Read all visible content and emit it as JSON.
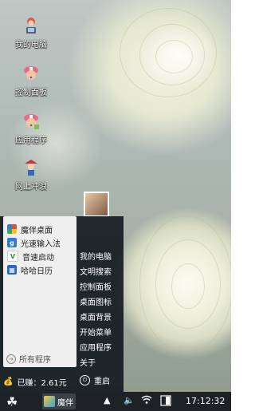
{
  "desktop": {
    "icons": [
      {
        "label": "我的电脑",
        "icon": "pirate-computer-icon"
      },
      {
        "label": "控制面板",
        "icon": "chopper-hat-icon"
      },
      {
        "label": "应用程序",
        "icon": "chopper-apps-icon"
      },
      {
        "label": "网上冲浪",
        "icon": "pirate-surf-icon"
      }
    ]
  },
  "start_menu": {
    "apps": [
      {
        "label": "魔伴桌面",
        "icon": "pinwheel-icon"
      },
      {
        "label": "光速输入法",
        "icon": "g-input-icon"
      },
      {
        "label": "音速启动",
        "icon": "v-launcher-icon"
      },
      {
        "label": "哈哈日历",
        "icon": "calendar-icon"
      }
    ],
    "all_programs": "所有程序",
    "right_items": [
      "我的电脑",
      "文明搜索",
      "控制面板",
      "桌面图标",
      "桌面背景",
      "开始菜单",
      "应用程序",
      "关于"
    ],
    "earned": "已赚：2.61元",
    "shutdown": "重启"
  },
  "taskbar": {
    "active_app": "魔伴",
    "clock": "17:12:32",
    "start_icon": "clover-icon"
  }
}
